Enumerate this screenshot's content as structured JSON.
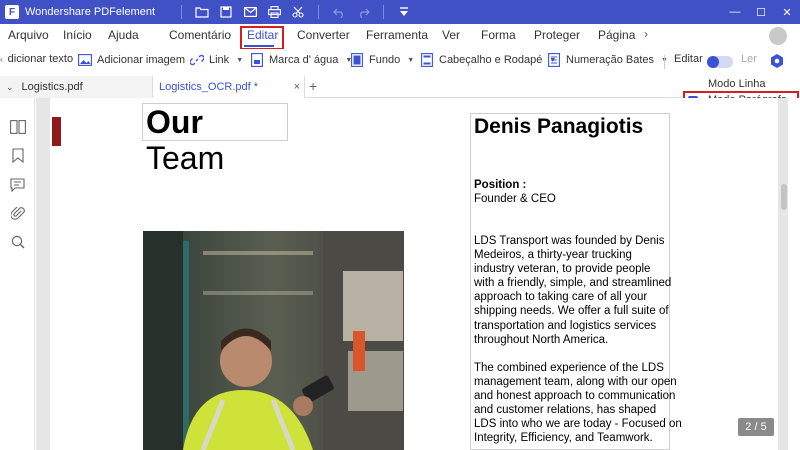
{
  "app": {
    "title": "Wondershare PDFelement",
    "logo_letter": "F"
  },
  "window_controls": {
    "minimize": "—",
    "maximize": "☐",
    "close": "✕"
  },
  "menu": {
    "items": [
      {
        "label": "Arquivo"
      },
      {
        "label": "Início"
      },
      {
        "label": "Ajuda"
      },
      {
        "label": "Comentário"
      },
      {
        "label": "Editar"
      },
      {
        "label": "Converter"
      },
      {
        "label": "Ferramenta"
      },
      {
        "label": "Ver"
      },
      {
        "label": "Forma"
      },
      {
        "label": "Proteger"
      },
      {
        "label": "Página"
      }
    ],
    "active": "Editar",
    "more": "›"
  },
  "toolbar": {
    "add_text": "dicionar texto",
    "add_image": "Adicionar imagem",
    "link": "Link",
    "watermark": "Marca d' água",
    "background": "Fundo",
    "header_footer": "Cabeçalho e Rodapé",
    "bates": "Numeração Bates",
    "edit": "Editar",
    "read": "Ler"
  },
  "tabs": [
    {
      "label": "Logistics.pdf"
    },
    {
      "label": "Logistics_OCR.pdf *"
    }
  ],
  "tab_add": "+",
  "tab_close": "×",
  "dropdown": {
    "options": [
      {
        "label": "Modo Linha",
        "checked": false
      },
      {
        "label": "Modo Parágrafo",
        "checked": true
      }
    ]
  },
  "document": {
    "heading_bold": "Our",
    "heading_rest": " Team",
    "person_name": "Denis Panagiotis",
    "position_label": "Position    :",
    "position_value": "Founder & CEO",
    "paragraph1": "LDS Transport was founded by Denis\nMedeiros, a thirty-year trucking\nindustry veteran, to provide people\nwith a friendly, simple, and streamlined\napproach to taking care of all your\nshipping needs. We offer a full suite of\ntransportation and logistics services\nthroughout North America.",
    "paragraph2": "The combined experience of the LDS\nmanagement team, along with our open\nand honest approach to communication\nand customer relations, has shaped\nLDS into who we are today - Focused on\nIntegrity, Efficiency, and Teamwork."
  },
  "page_counter": "2 / 5",
  "colors": {
    "brand": "#3f51c4",
    "accent": "#3a52d8",
    "highlight": "#d21f1f"
  }
}
